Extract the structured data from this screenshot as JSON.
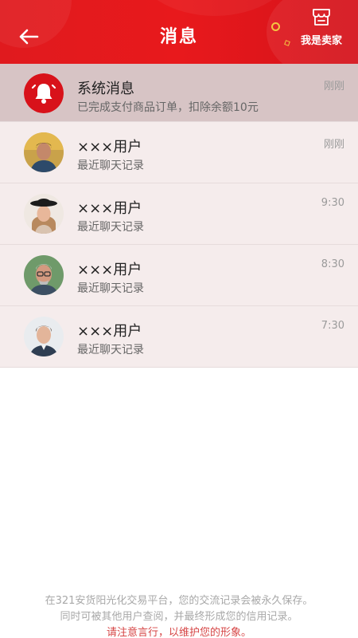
{
  "header": {
    "title": "消息",
    "seller_label": "我是卖家",
    "colors": {
      "background": "#e8191c",
      "accent_dot": "#f4c542"
    }
  },
  "messages": [
    {
      "name": "系统消息",
      "preview": "已完成支付商品订单，扣除余额10元",
      "time": "刚刚",
      "avatar": "bell-icon"
    },
    {
      "name": "×××用户",
      "preview": "最近聊天记录",
      "time": "刚刚",
      "avatar": "user-avatar-1"
    },
    {
      "name": "×××用户",
      "preview": "最近聊天记录",
      "time": "9:30",
      "avatar": "user-avatar-2"
    },
    {
      "name": "×××用户",
      "preview": "最近聊天记录",
      "time": "8:30",
      "avatar": "user-avatar-3"
    },
    {
      "name": "×××用户",
      "preview": "最近聊天记录",
      "time": "7:30",
      "avatar": "user-avatar-4"
    }
  ],
  "footer": {
    "line1": "在321安货阳光化交易平台，您的交流记录会被永久保存。",
    "line2": "同时可被其他用户查阅，并最终形成您的信用记录。",
    "line3": "请注意言行，以维护您的形象。"
  }
}
